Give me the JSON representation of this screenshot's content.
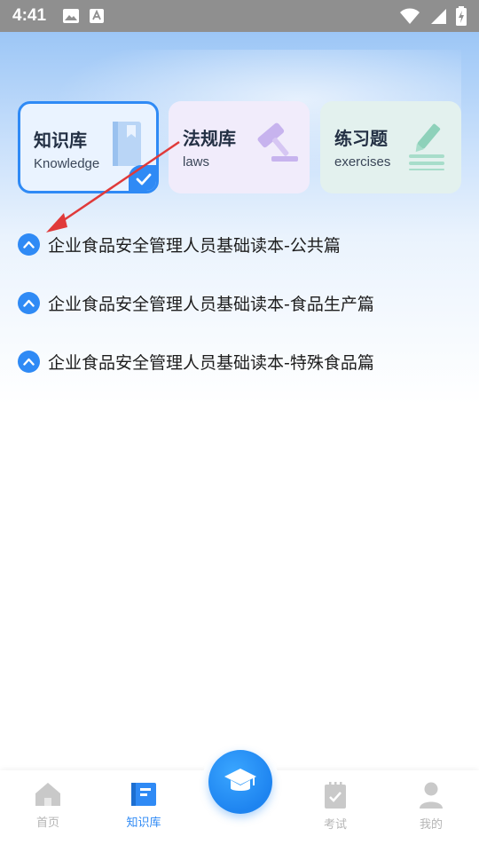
{
  "status_bar": {
    "time": "4:41"
  },
  "cards": [
    {
      "title": "知识库",
      "subtitle": "Knowledge",
      "selected": true,
      "accent": "#2f8af5"
    },
    {
      "title": "法规库",
      "subtitle": "laws",
      "selected": false,
      "accent": "#b79be6"
    },
    {
      "title": "练习题",
      "subtitle": "exercises",
      "selected": false,
      "accent": "#6fc3a9"
    }
  ],
  "list": [
    {
      "label": "企业食品安全管理人员基础读本-公共篇"
    },
    {
      "label": "企业食品安全管理人员基础读本-食品生产篇"
    },
    {
      "label": "企业食品安全管理人员基础读本-特殊食品篇"
    }
  ],
  "tabbar": {
    "items": [
      {
        "label": "首页",
        "icon": "home-icon",
        "active": false
      },
      {
        "label": "知识库",
        "icon": "book-icon",
        "active": true
      },
      {
        "label": "",
        "icon": "graduation-cap-icon",
        "active": false
      },
      {
        "label": "考试",
        "icon": "clipboard-check-icon",
        "active": false
      },
      {
        "label": "我的",
        "icon": "person-icon",
        "active": false
      }
    ]
  },
  "colors": {
    "primary": "#2f8af5",
    "annotation_arrow": "#e03a3a"
  }
}
